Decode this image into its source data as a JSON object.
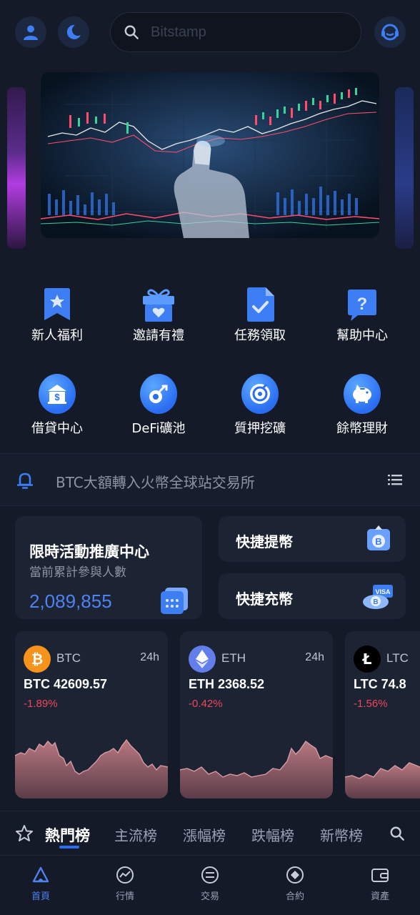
{
  "header": {
    "search_placeholder": "Bitstamp",
    "icons": [
      "user-icon",
      "moon-icon",
      "search-icon",
      "support-icon"
    ]
  },
  "quick_grid": [
    {
      "label": "新人福利",
      "icon": "bookmark-star-icon"
    },
    {
      "label": "邀請有禮",
      "icon": "gift-icon"
    },
    {
      "label": "任務領取",
      "icon": "task-document-icon"
    },
    {
      "label": "幫助中心",
      "icon": "help-chat-icon"
    },
    {
      "label": "借貸中心",
      "icon": "bank-dollar-icon"
    },
    {
      "label": "DeFi礦池",
      "icon": "mining-icon"
    },
    {
      "label": "質押挖礦",
      "icon": "staking-icon"
    },
    {
      "label": "餘幣理財",
      "icon": "piggy-bank-icon"
    }
  ],
  "notice": {
    "text": "BTC大額轉入火幣全球站交易所"
  },
  "promo": {
    "title": "限時活動推廣中心",
    "subtitle": "當前累計參與人數",
    "count": "2,089,855"
  },
  "quick_actions": {
    "withdraw": "快捷提幣",
    "deposit": "快捷充幣"
  },
  "markets": [
    {
      "symbol": "BTC",
      "period": "24h",
      "price": "BTC 42609.57",
      "change": "-1.89%",
      "color": "#f7931a"
    },
    {
      "symbol": "ETH",
      "period": "24h",
      "price": "ETH 2368.52",
      "change": "-0.42%",
      "color": "#627eea"
    },
    {
      "symbol": "LTC",
      "period": "24h",
      "price": "LTC 74.8",
      "change": "-1.56%",
      "color": "#000000"
    }
  ],
  "tabs": [
    "熱門榜",
    "主流榜",
    "漲幅榜",
    "跌幅榜",
    "新幣榜"
  ],
  "bottom_nav": [
    {
      "label": "首頁",
      "icon": "home-icon",
      "active": true
    },
    {
      "label": "行情",
      "icon": "market-icon",
      "active": false
    },
    {
      "label": "交易",
      "icon": "trade-icon",
      "active": false
    },
    {
      "label": "合約",
      "icon": "contract-icon",
      "active": false
    },
    {
      "label": "資產",
      "icon": "wallet-icon",
      "active": false
    }
  ],
  "colors": {
    "accent": "#2a6df2",
    "negative": "#f0465a",
    "background": "#141a28",
    "card": "#1c2333"
  }
}
